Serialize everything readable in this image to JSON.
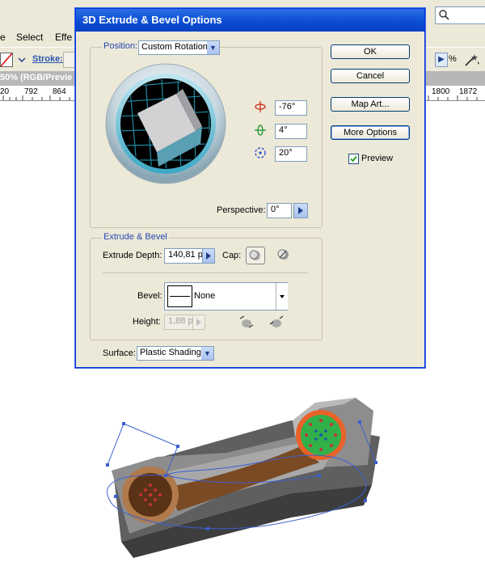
{
  "app": {
    "menus": [
      {
        "label": "e"
      },
      {
        "label": "Select"
      },
      {
        "label": "Effe"
      }
    ],
    "stroke_label": "Stroke:",
    "percent_sign": "%",
    "doc_title": "50% (RGB/Previe",
    "ruler_left": [
      "20",
      "792",
      "864"
    ],
    "ruler_right": [
      "1800",
      "1872"
    ]
  },
  "dialog": {
    "title": "3D Extrude & Bevel Options",
    "position_label": "Position:",
    "position_value": "Custom Rotation",
    "rotation_x": "-76°",
    "rotation_y": "4°",
    "rotation_z": "20°",
    "perspective_label": "Perspective:",
    "perspective_value": "0°",
    "extrude_title": "Extrude & Bevel",
    "extrude_depth_label": "Extrude Depth:",
    "extrude_depth_value": "140,81 p",
    "cap_label": "Cap:",
    "bevel_label": "Bevel:",
    "bevel_value": "None",
    "height_label": "Height:",
    "height_value": "1,88 p",
    "surface_label": "Surface:",
    "surface_value": "Plastic Shading",
    "buttons": {
      "ok": "OK",
      "cancel": "Cancel",
      "map_art": "Map Art...",
      "more_options": "More Options"
    },
    "preview_label": "Preview",
    "preview_checked": true
  },
  "colors": {
    "title_bar": "#0a4bd2",
    "group_title": "#2748b4",
    "cube_side": "#59a0b5"
  }
}
